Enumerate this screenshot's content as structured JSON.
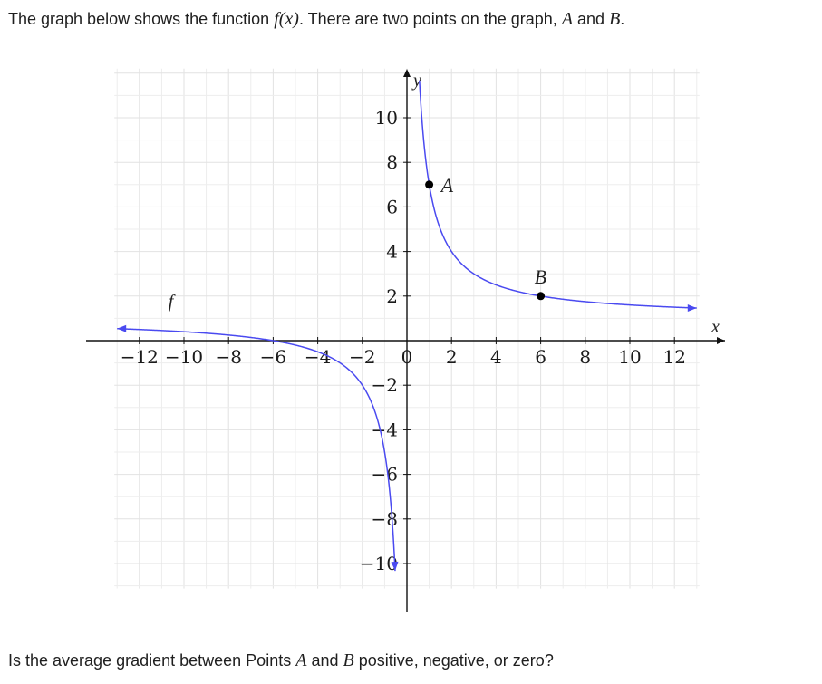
{
  "question": {
    "intro_1": "The graph below shows the function ",
    "f_symbol": "f",
    "f_arg": "(x)",
    "intro_2": ". There are two points on the graph, ",
    "point_a": "A",
    "intro_and": " and ",
    "point_b": "B",
    "intro_end": ".",
    "ask_1": "Is the average gradient between Points ",
    "ask_a": "A",
    "ask_and": " and ",
    "ask_b": "B",
    "ask_2": " positive, negative, or zero?"
  },
  "chart_data": {
    "type": "line",
    "title": "",
    "xlabel": "x",
    "ylabel": "y",
    "xlim": [
      -13,
      13
    ],
    "ylim": [
      -11,
      12
    ],
    "grid": true,
    "x_ticks": [
      -12,
      -10,
      -8,
      -6,
      -4,
      -2,
      0,
      2,
      4,
      6,
      8,
      10,
      12
    ],
    "x_tick_labels": [
      "−12",
      "−10",
      "−8",
      "−6",
      "−4",
      "−2",
      "0",
      "2",
      "4",
      "6",
      "8",
      "10",
      "12"
    ],
    "y_ticks": [
      10,
      8,
      6,
      4,
      2,
      -2,
      -4,
      -6,
      -8,
      -10
    ],
    "y_tick_labels": [
      "10",
      "8",
      "6",
      "4",
      "2",
      "−2",
      "−4",
      "−6",
      "−8",
      "−10"
    ],
    "series": [
      {
        "name": "f",
        "color": "#4a4af0",
        "asymptote_x": 0,
        "asymptote_y": 1,
        "function": "1 + 6/x",
        "x_from": -13,
        "x_to": 13
      }
    ],
    "points": [
      {
        "label": "A",
        "x": 1,
        "y": 7
      },
      {
        "label": "B",
        "x": 6,
        "y": 2
      }
    ]
  }
}
